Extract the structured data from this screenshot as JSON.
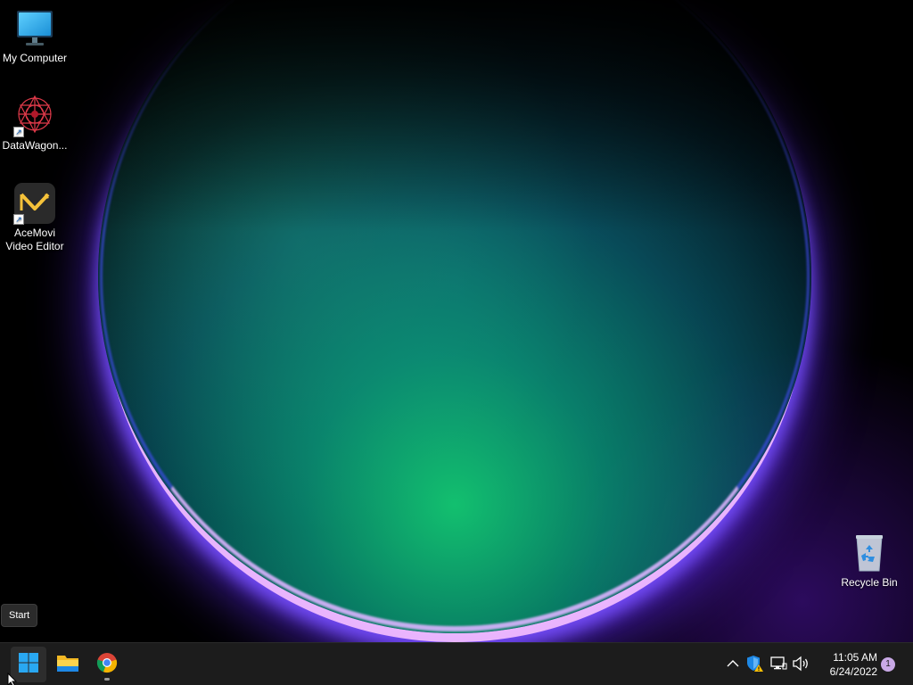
{
  "desktop": {
    "icons": [
      {
        "label": "My Computer",
        "icon": "monitor-icon"
      },
      {
        "label": "DataWagon...",
        "icon": "datawagon-icon",
        "shortcut": true
      },
      {
        "label": "AceMovi Video Editor",
        "icon": "acemovi-icon",
        "shortcut": true
      },
      {
        "label": "Recycle Bin",
        "icon": "recycle-bin-icon"
      }
    ]
  },
  "tooltip": {
    "text": "Start"
  },
  "taskbar": {
    "pinned": [
      {
        "name": "Start",
        "icon": "windows-start-icon"
      },
      {
        "name": "File Explorer",
        "icon": "folder-icon"
      },
      {
        "name": "Google Chrome",
        "icon": "chrome-icon"
      }
    ],
    "tray": {
      "icons": [
        "chevron-up-icon",
        "security-warning-icon",
        "network-icon",
        "volume-icon"
      ],
      "time": "11:05 AM",
      "date": "6/24/2022",
      "notification_count": "1"
    }
  },
  "colors": {
    "taskbar_bg": "#1c1c1c",
    "accent": "#0078d4"
  }
}
